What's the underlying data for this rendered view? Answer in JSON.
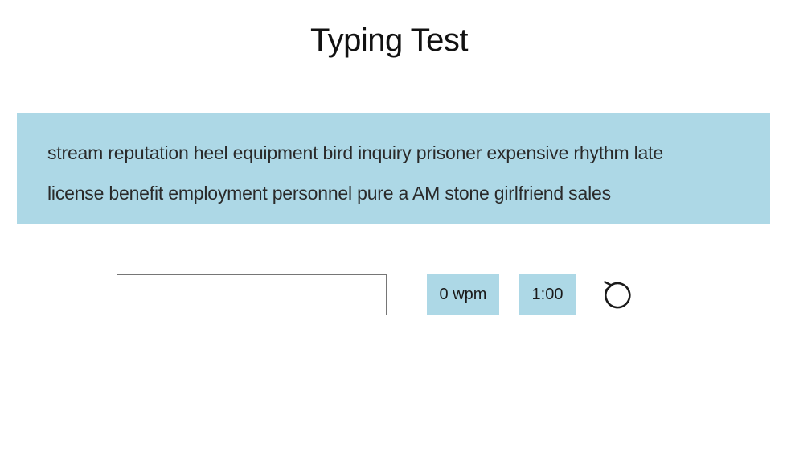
{
  "header": {
    "title": "Typing Test"
  },
  "words": {
    "line1": "stream reputation heel equipment bird inquiry prisoner expensive rhythm late",
    "line2": "license benefit employment personnel pure a AM stone girlfriend sales"
  },
  "input": {
    "value": "",
    "placeholder": ""
  },
  "stats": {
    "wpm_label": "0 wpm",
    "timer_label": "1:00"
  },
  "controls": {
    "restart_icon": "restart-icon"
  },
  "colors": {
    "accent": "#add8e6",
    "text": "#222222",
    "background": "#ffffff"
  }
}
